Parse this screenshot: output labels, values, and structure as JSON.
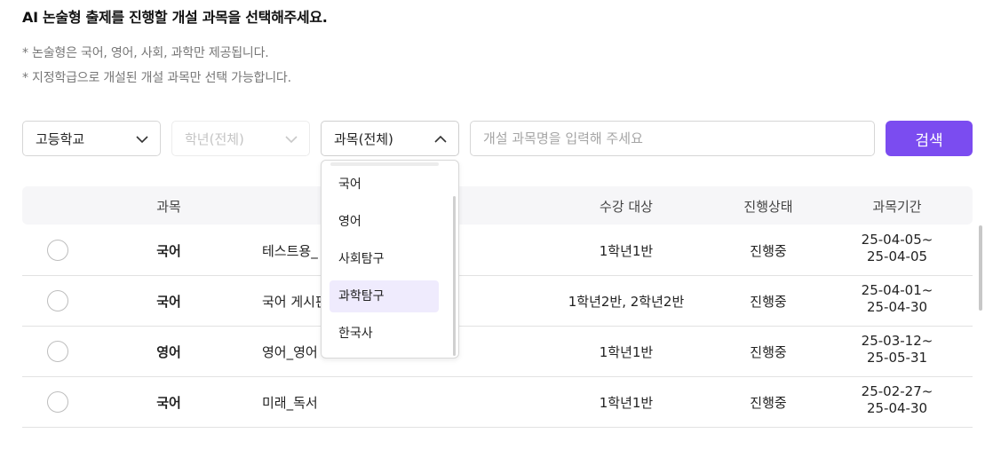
{
  "header": {
    "title": "AI 논술형 출제를 진행할 개설 과목을 선택해주세요.",
    "notes": [
      "* 논술형은 국어, 영어, 사회, 과학만 제공됩니다.",
      "* 지정학급으로 개설된 개설 과목만 선택 가능합니다."
    ]
  },
  "filters": {
    "school": {
      "value": "고등학교"
    },
    "grade": {
      "value": "학년(전체)",
      "disabled": true
    },
    "subject": {
      "value": "과목(전체)",
      "open": true
    },
    "search": {
      "placeholder": "개설 과목명을 입력해 주세요",
      "value": ""
    },
    "search_button": "검색"
  },
  "dropdown": {
    "options": [
      "국어",
      "영어",
      "사회탐구",
      "과학탐구",
      "한국사"
    ],
    "highlighted": "과학탐구"
  },
  "table": {
    "columns": {
      "subject": "과목",
      "target": "수강 대상",
      "status": "진행상태",
      "period": "과목기간"
    },
    "rows": [
      {
        "subject": "국어",
        "name": "테스트용_",
        "target": "1학년1반",
        "status": "진행중",
        "period_start": "25-04-05~",
        "period_end": "25-04-05"
      },
      {
        "subject": "국어",
        "name": "국어 게시판",
        "target": "1학년2반, 2학년2반",
        "status": "진행중",
        "period_start": "25-04-01~",
        "period_end": "25-04-30"
      },
      {
        "subject": "영어",
        "name": "영어_영어",
        "target": "1학년1반",
        "status": "진행중",
        "period_start": "25-03-12~",
        "period_end": "25-05-31"
      },
      {
        "subject": "국어",
        "name": "미래_독서",
        "target": "1학년1반",
        "status": "진행중",
        "period_start": "25-02-27~",
        "period_end": "25-04-30"
      }
    ]
  },
  "colors": {
    "accent": "#7b4cf0",
    "highlight": "#efebfd"
  },
  "icons": {
    "select_closed": "chevron-down-icon",
    "select_open": "chevron-up-icon"
  }
}
